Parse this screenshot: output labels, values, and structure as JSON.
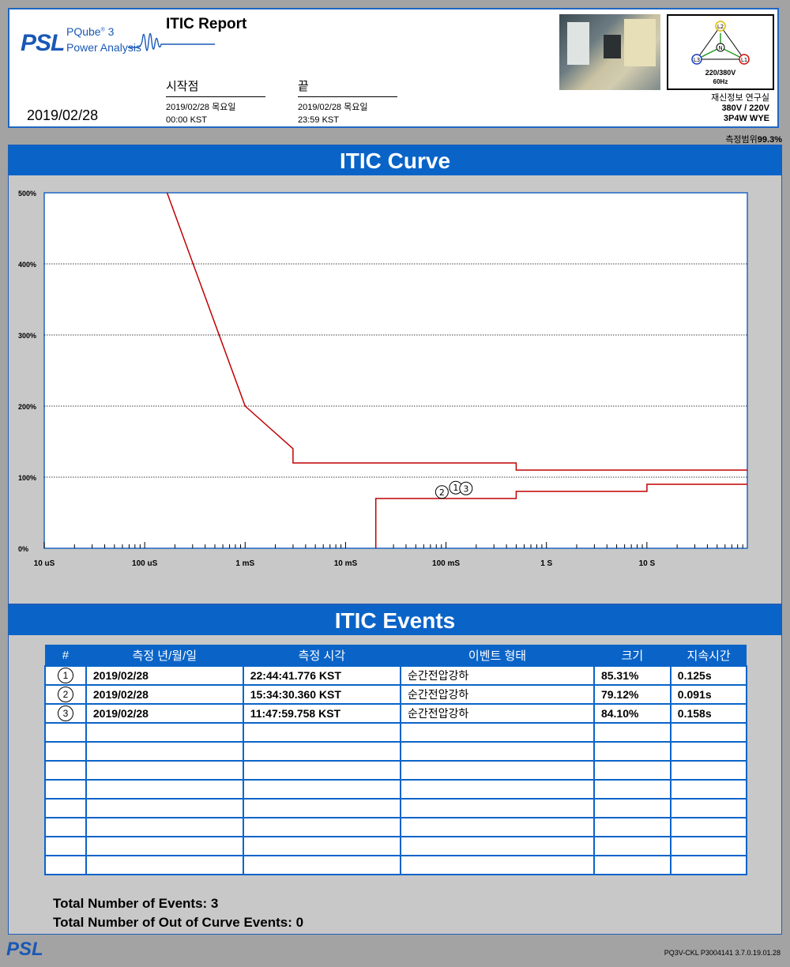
{
  "header": {
    "brand_short": "PSL",
    "product": "PQube",
    "product_sup": "®",
    "product_num": "3",
    "product_sub": "Power Analysis",
    "report_title": "ITIC Report",
    "report_date": "2019/02/28",
    "start": {
      "label": "시작점",
      "date": "2019/02/28 목요일",
      "time": "00:00 KST"
    },
    "end": {
      "label": "끝",
      "date": "2019/02/28 목요일",
      "time": "23:59 KST"
    },
    "phase_labels": [
      "L2",
      "N",
      "L3",
      "L1"
    ],
    "nominal_voltage": "220/380V",
    "frequency": "60Hz",
    "site_name": "재신정보 연구실",
    "site_voltage": "380V / 220V",
    "site_wiring": "3P4W WYE",
    "coverage_label": "측정범위",
    "coverage_value": "99.3%"
  },
  "curve_section": {
    "title": "ITIC Curve"
  },
  "chart_data": {
    "type": "line",
    "title": "ITIC Curve",
    "xlabel": "",
    "ylabel": "",
    "x_scale": "log",
    "xlim_seconds": [
      1e-05,
      100
    ],
    "ylim_percent": [
      0,
      500
    ],
    "x_ticks": [
      {
        "value": 1e-05,
        "label": "10 uS"
      },
      {
        "value": 0.0001,
        "label": "100 uS"
      },
      {
        "value": 0.001,
        "label": "1 mS"
      },
      {
        "value": 0.01,
        "label": "10 mS"
      },
      {
        "value": 0.1,
        "label": "100 mS"
      },
      {
        "value": 1,
        "label": "1 S"
      },
      {
        "value": 10,
        "label": "10 S"
      }
    ],
    "y_ticks": [
      {
        "value": 0,
        "label": "0%"
      },
      {
        "value": 100,
        "label": "100%"
      },
      {
        "value": 200,
        "label": "200%"
      },
      {
        "value": 300,
        "label": "300%"
      },
      {
        "value": 400,
        "label": "400%"
      },
      {
        "value": 500,
        "label": "500%"
      }
    ],
    "grid": "horizontal dotted",
    "series": [
      {
        "points": [
          [
            0.000167,
            500
          ],
          [
            0.001,
            200
          ],
          [
            0.003,
            140
          ],
          [
            0.003,
            120
          ],
          [
            0.5,
            120
          ],
          [
            0.5,
            110
          ],
          [
            100,
            110
          ]
        ]
      },
      {
        "points": [
          [
            0.02,
            0
          ],
          [
            0.02,
            70
          ],
          [
            0.5,
            70
          ],
          [
            0.5,
            80
          ],
          [
            10,
            80
          ],
          [
            10,
            90
          ],
          [
            100,
            90
          ]
        ]
      }
    ],
    "events": [
      {
        "id": "1",
        "duration_s": 0.125,
        "magnitude_percent": 85.31
      },
      {
        "id": "2",
        "duration_s": 0.091,
        "magnitude_percent": 79.12
      },
      {
        "id": "3",
        "duration_s": 0.158,
        "magnitude_percent": 84.1
      }
    ],
    "line_color": "#c00000"
  },
  "events_section": {
    "title": "ITIC Events",
    "columns": [
      "#",
      "측정 년/월/일",
      "측정 시각",
      "이벤트 형태",
      "크기",
      "지속시간"
    ],
    "rows": [
      {
        "num": "1",
        "date": "2019/02/28",
        "time": "22:44:41.776 KST",
        "type": "순간전압강하",
        "magnitude": "85.31%",
        "duration": "0.125s"
      },
      {
        "num": "2",
        "date": "2019/02/28",
        "time": "15:34:30.360 KST",
        "type": "순간전압강하",
        "magnitude": "79.12%",
        "duration": "0.091s"
      },
      {
        "num": "3",
        "date": "2019/02/28",
        "time": "11:47:59.758 KST",
        "type": "순간전압강하",
        "magnitude": "84.10%",
        "duration": "0.158s"
      }
    ],
    "total_events": "Total Number of Events: 3",
    "total_out_of_curve": "Total Number of Out of Curve Events: 0"
  },
  "footer": {
    "brand": "PSL",
    "device_id": "PQ3V-CKL   P3004141  3.7.0.19.01.28"
  },
  "colors": {
    "accent": "#0a64c8",
    "curve": "#c00000",
    "frame": "#a3a3a3"
  }
}
